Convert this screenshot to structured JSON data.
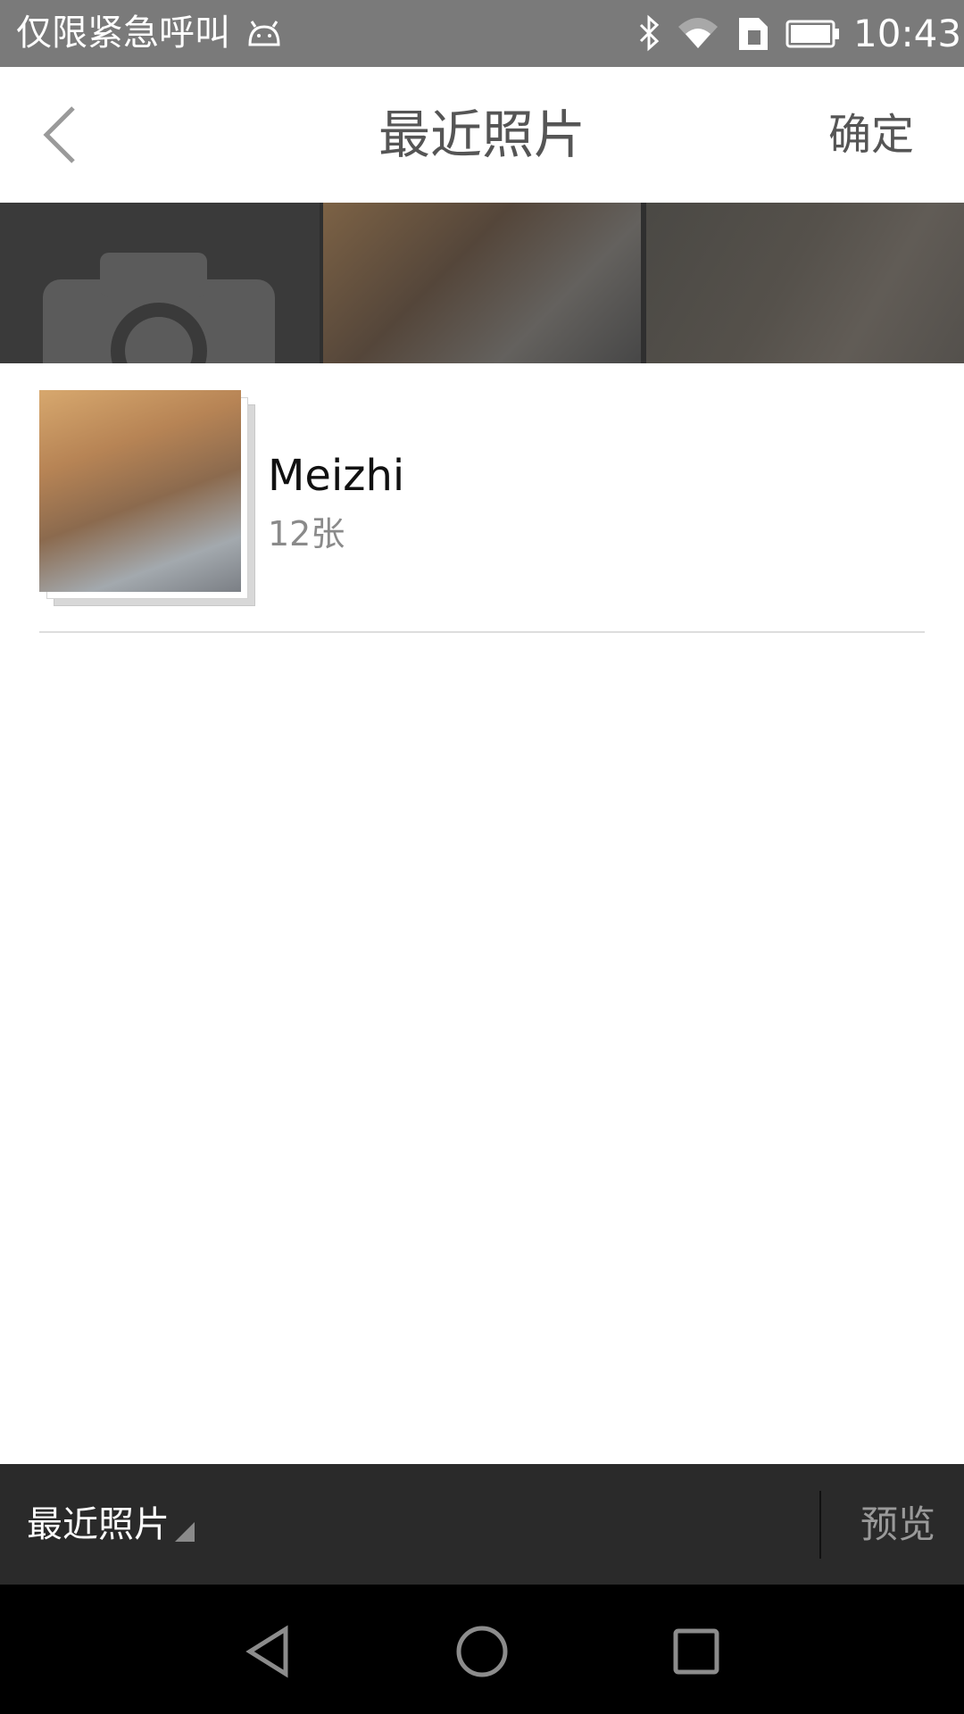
{
  "status_bar": {
    "carrier": "仅限紧急呼叫",
    "time": "10:43",
    "icons": [
      "android-icon",
      "bluetooth-icon",
      "wifi-icon",
      "sim-icon",
      "battery-icon"
    ]
  },
  "header": {
    "back_icon": "chevron-left-icon",
    "title": "最近照片",
    "confirm_label": "确定"
  },
  "strip": {
    "camera_icon": "camera-icon",
    "photos": [
      "photo-1",
      "photo-2"
    ]
  },
  "albums": [
    {
      "name": "Meizhi",
      "count": "12张"
    }
  ],
  "bottom_bar": {
    "album_selector": "最近照片",
    "preview_label": "预览"
  },
  "nav": {
    "back_icon": "back-triangle-icon",
    "home_icon": "home-circle-icon",
    "recent_icon": "recent-square-icon"
  },
  "colors": {
    "status_bar_bg": "#7a7a7a",
    "bottom_bar_bg": "#2a2a2a",
    "nav_bg": "#000000"
  }
}
